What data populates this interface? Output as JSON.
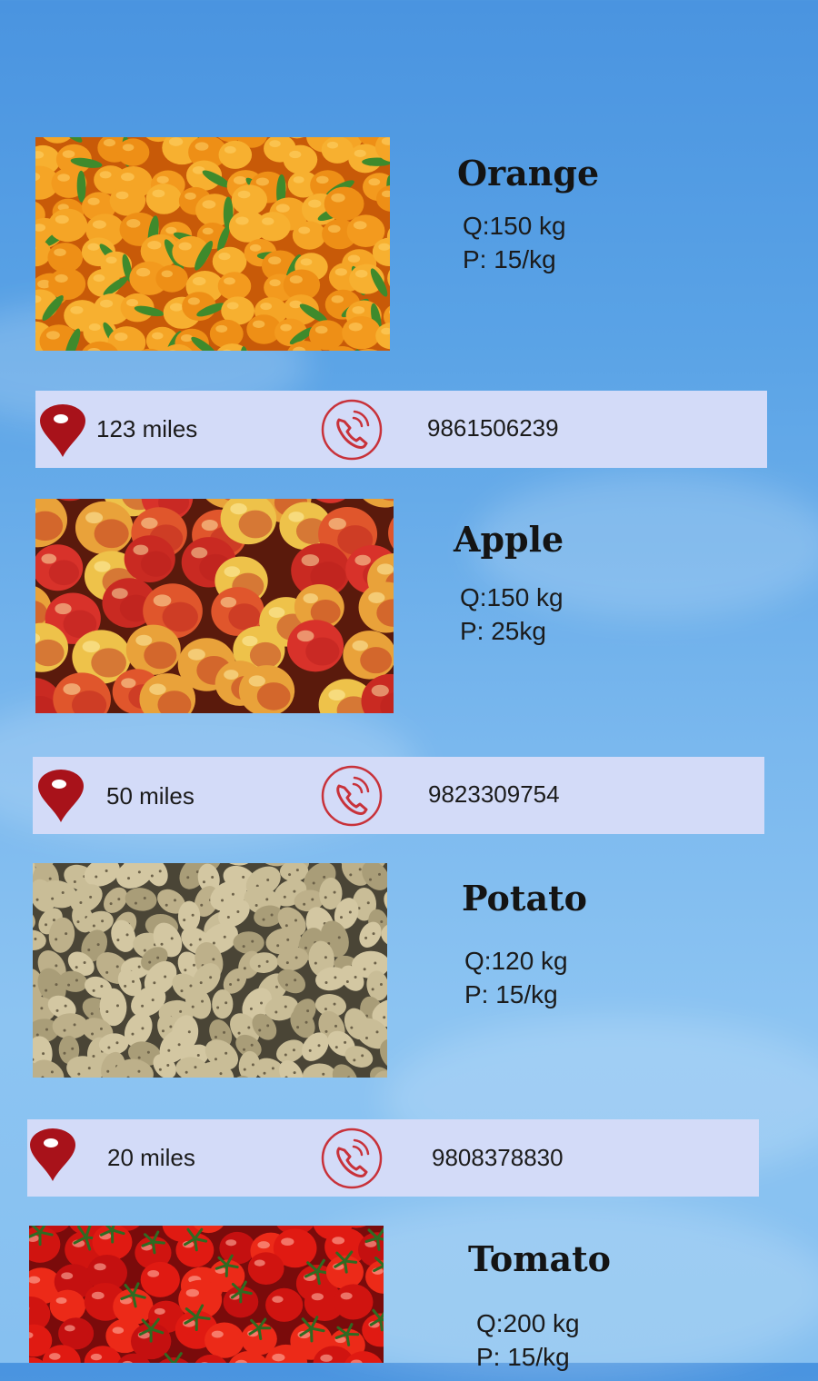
{
  "products": [
    {
      "name": "Orange",
      "quantity": "Q:150 kg",
      "price": "P: 15/kg",
      "photo_icon": "orange-photo",
      "distance": "123 miles",
      "phone": "9861506239"
    },
    {
      "name": "Apple",
      "quantity": "Q:150 kg",
      "price": "P: 25kg",
      "photo_icon": "apple-photo",
      "distance": "50 miles",
      "phone": "9823309754"
    },
    {
      "name": "Potato",
      "quantity": "Q:120 kg",
      "price": "P: 15/kg",
      "photo_icon": "potato-photo",
      "distance": "20 miles",
      "phone": "9808378830"
    },
    {
      "name": "Tomato",
      "quantity": "Q:200 kg",
      "price": "P: 15/kg",
      "photo_icon": "tomato-photo"
    }
  ],
  "colors": {
    "background": "#5aa3e6",
    "contact_bar": "#d3dbf8",
    "pin": "#a8121a",
    "phone_icon": "#c8323a"
  },
  "icons": {
    "location": "map-pin-icon",
    "call": "phone-call-icon"
  }
}
